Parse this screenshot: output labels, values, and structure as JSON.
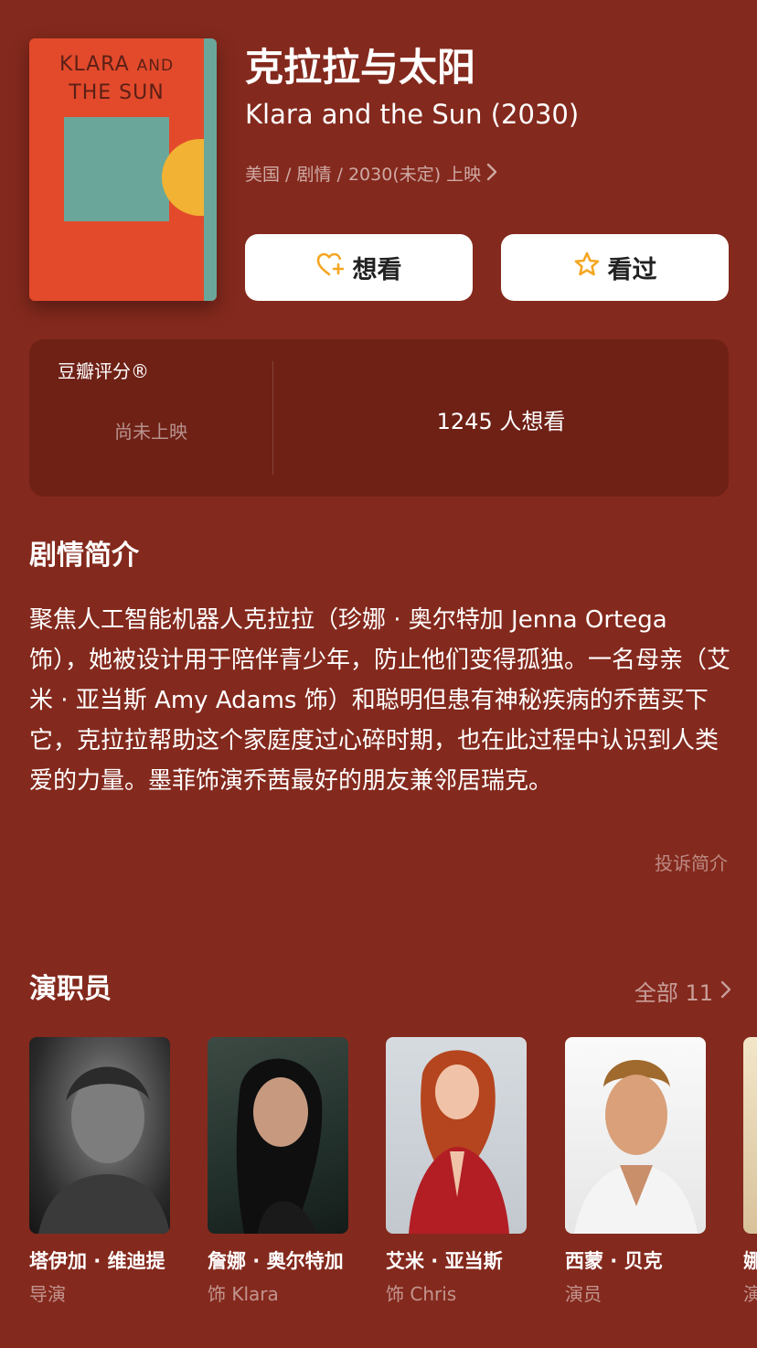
{
  "poster": {
    "line1": "KLARA",
    "line1b": "AND",
    "line2": "THE SUN"
  },
  "title_cn": "克拉拉与太阳",
  "title_en": "Klara and the Sun (2030)",
  "meta": "美国 / 剧情 / 2030(未定) 上映",
  "actions": {
    "want_label": "想看",
    "seen_label": "看过"
  },
  "rating": {
    "label": "豆瓣评分®",
    "status": "尚未上映",
    "want_count": "1245 人想看"
  },
  "synopsis": {
    "title": "剧情简介",
    "text": "聚焦人工智能机器人克拉拉（珍娜 · 奥尔特加 Jenna Ortega 饰），她被设计用于陪伴青少年，防止他们变得孤独。一名母亲（艾米 · 亚当斯 Amy Adams 饰）和聪明但患有神秘疾病的乔茜买下它，克拉拉帮助这个家庭度过心碎时期，也在此过程中认识到人类爱的力量。墨菲饰演乔茜最好的朋友兼邻居瑞克。",
    "report_label": "投诉简介"
  },
  "cast": {
    "title": "演职员",
    "all_label": "全部 11",
    "members": [
      {
        "name": "塔伊加 · 维迪提",
        "role": "导演"
      },
      {
        "name": "詹娜 · 奥尔特加",
        "role": "饰 Klara"
      },
      {
        "name": "艾米 · 亚当斯",
        "role": "饰 Chris"
      },
      {
        "name": "西蒙 · 贝克",
        "role": "演员"
      },
      {
        "name": "娜",
        "role": "演"
      }
    ]
  },
  "colors": {
    "background": "#84291d",
    "card": "#6f2116",
    "accent": "#f5a623"
  }
}
